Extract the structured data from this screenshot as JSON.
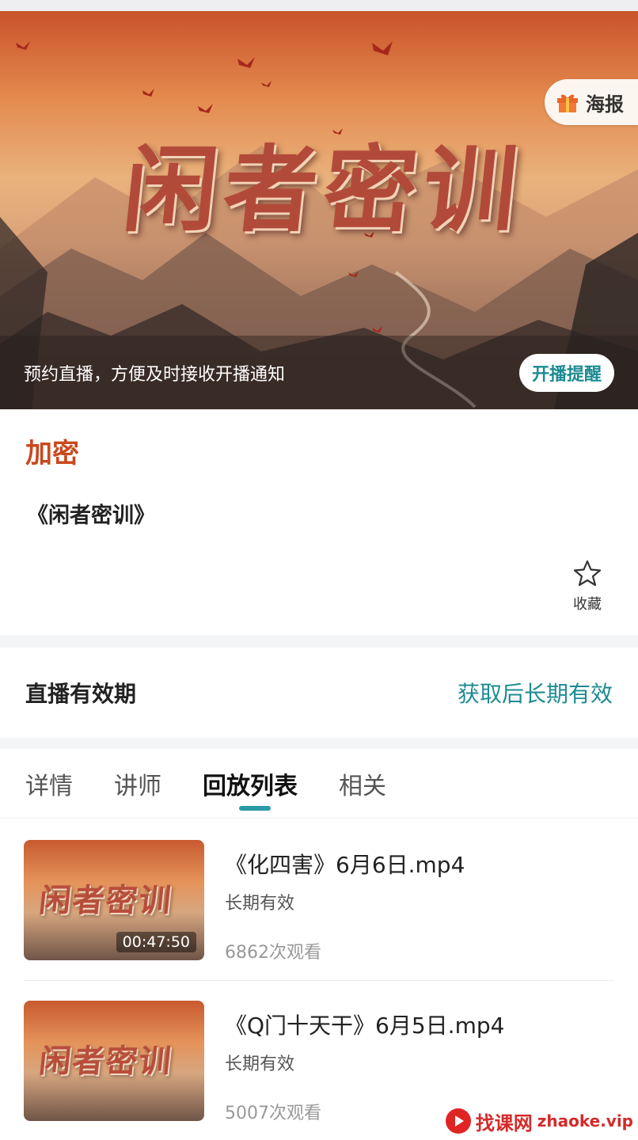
{
  "banner": {
    "title": "闲者密训",
    "poster_label": "海报",
    "notice_text": "预约直播，方便及时接收开播通知",
    "remind_button": "开播提醒"
  },
  "info": {
    "tag": "加密",
    "course_title": "《闲者密训》",
    "favorite_label": "收藏"
  },
  "validity": {
    "label": "直播有效期",
    "value": "获取后长期有效"
  },
  "tabs": [
    {
      "label": "详情",
      "active": false
    },
    {
      "label": "讲师",
      "active": false
    },
    {
      "label": "回放列表",
      "active": true
    },
    {
      "label": "相关",
      "active": false
    }
  ],
  "playlist": [
    {
      "thumb_title": "闲者密训",
      "duration": "00:47:50",
      "name": "《化四害》6月6日.mp4",
      "validity": "长期有效",
      "views": "6862次观看"
    },
    {
      "thumb_title": "闲者密训",
      "duration": "",
      "name": "《Q门十天干》6月5日.mp4",
      "validity": "长期有效",
      "views": "5007次观看"
    }
  ],
  "watermark": {
    "cn": "找课网",
    "en": "zhaoke.vip"
  },
  "colors": {
    "accent_teal": "#1d8b92",
    "tag_red": "#c8491f",
    "indicator": "#2a9aa6"
  }
}
